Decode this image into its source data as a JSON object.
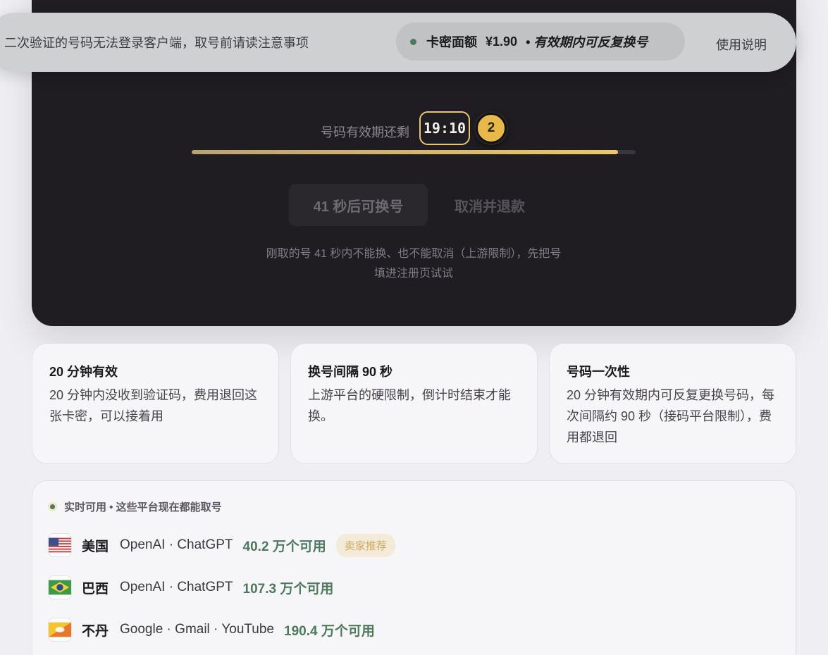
{
  "notice": {
    "text": "二次验证的号码无法登录客户端，取号前请读注意事项",
    "price_label": "卡密面额",
    "price_value": "¥1.90",
    "price_note": "• 有效期内可反复换号",
    "help_link": "使用说明"
  },
  "timer": {
    "label": "号码有效期还剩",
    "value": "19:10",
    "badge": "2",
    "progress": 0.96
  },
  "actions": {
    "swap_label": "41 秒后可换号",
    "cancel_label": "取消并退款",
    "hint_line1": "刚取的号 41 秒内不能换、也不能取消（上游限制），先把号",
    "hint_line2": "填进注册页试试"
  },
  "info_cards": [
    {
      "title": "20 分钟有效",
      "desc": "20 分钟内没收到验证码，费用退回这张卡密，可以接着用"
    },
    {
      "title": "换号间隔 90 秒",
      "desc": "上游平台的硬限制，倒计时结束才能换。"
    },
    {
      "title": "号码一次性",
      "desc": "20 分钟有效期内可反复更换号码，每次间隔约 90 秒（接码平台限制），费用都退回"
    }
  ],
  "availability": {
    "header": "实时可用 • 这些平台现在都能取号",
    "rows": [
      {
        "flag": "us-flag",
        "country": "美国",
        "service": "OpenAI · ChatGPT",
        "count": "40.2 万个可用",
        "badge": "卖家推荐"
      },
      {
        "flag": "br-flag",
        "country": "巴西",
        "service": "OpenAI · ChatGPT",
        "count": "107.3 万个可用"
      },
      {
        "flag": "bt-flag",
        "country": "不丹",
        "service": "Google · Gmail · YouTube",
        "count": "190.4 万个可用"
      }
    ]
  },
  "colors": {
    "dark_card": "#1f1c22",
    "accent_gold": "#e6c672",
    "available_green": "#4d7a5c"
  }
}
